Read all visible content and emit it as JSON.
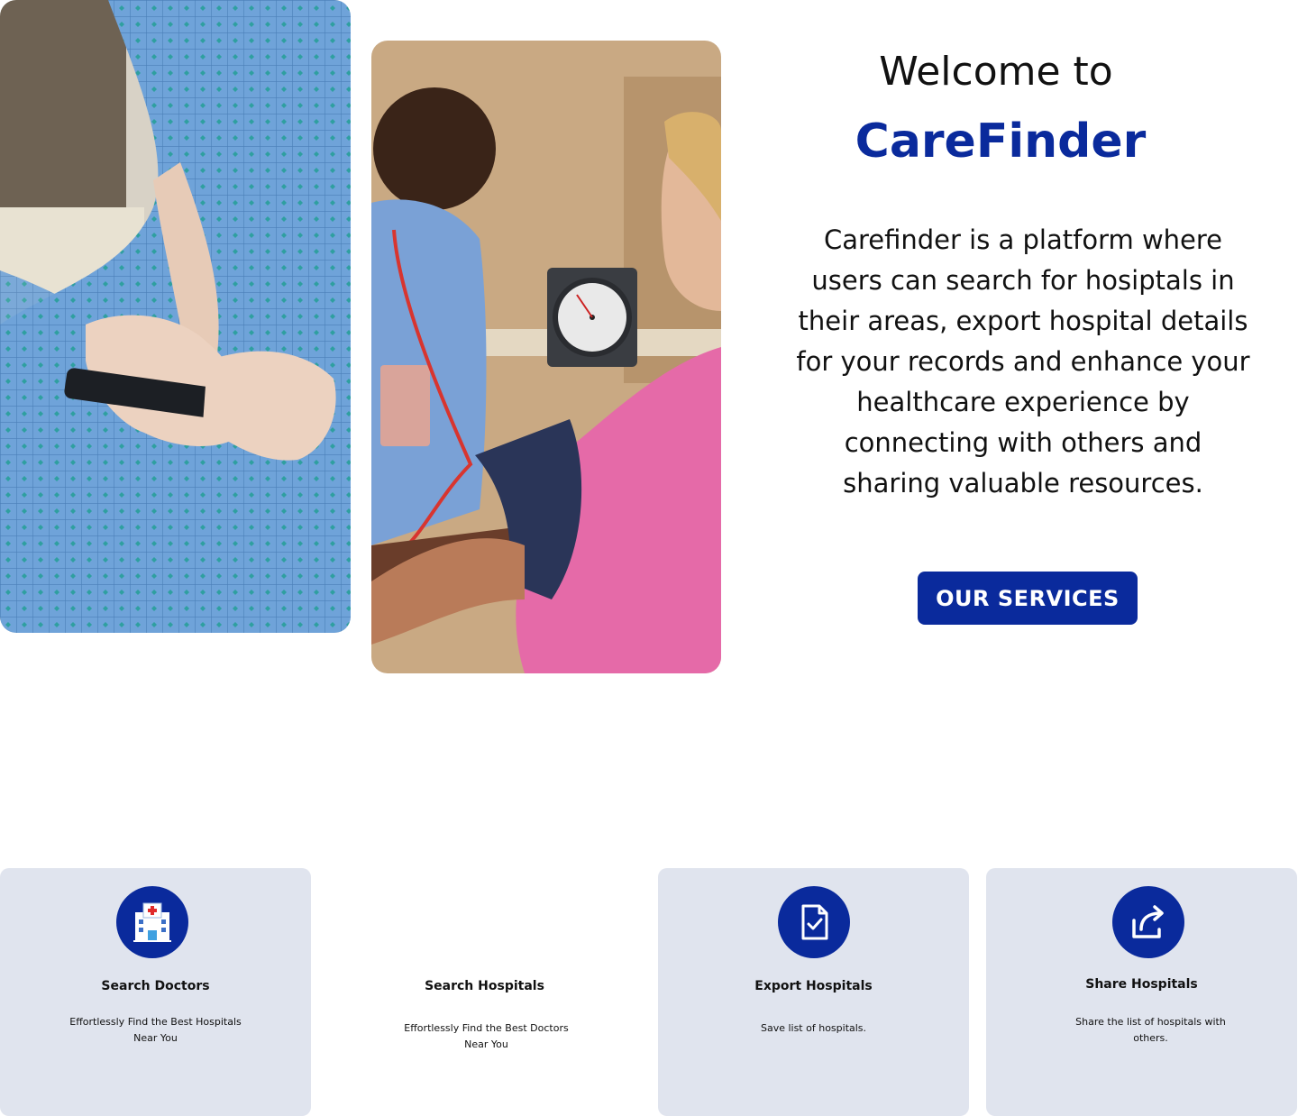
{
  "hero": {
    "welcome_line": "Welcome to",
    "brand_name": "CareFinder",
    "description": "Carefinder is a platform where users can search for hosiptals in their areas, export hospital details for your records and  enhance your healthcare experience by connecting with others and sharing valuable resources.",
    "cta_label": "OUR SERVICES"
  },
  "images": {
    "left_photo": "patient-in-gown-using-phone",
    "right_photo": "nurse-taking-blood-pressure"
  },
  "services": [
    {
      "icon": "hospital-icon",
      "title": "Search Doctors",
      "text": "Effortlessly Find the Best Hospitals Near You"
    },
    {
      "icon": "",
      "title": "Search Hospitals",
      "text": "Effortlessly Find the Best Doctors Near You"
    },
    {
      "icon": "document-check-icon",
      "title": "Export Hospitals",
      "text": "Save list of hospitals."
    },
    {
      "icon": "share-icon",
      "title": "Share Hospitals",
      "text": "Share the list of hospitals with others."
    }
  ],
  "colors": {
    "brand_blue": "#0a2a9c",
    "card_background": "#e0e4ee"
  }
}
